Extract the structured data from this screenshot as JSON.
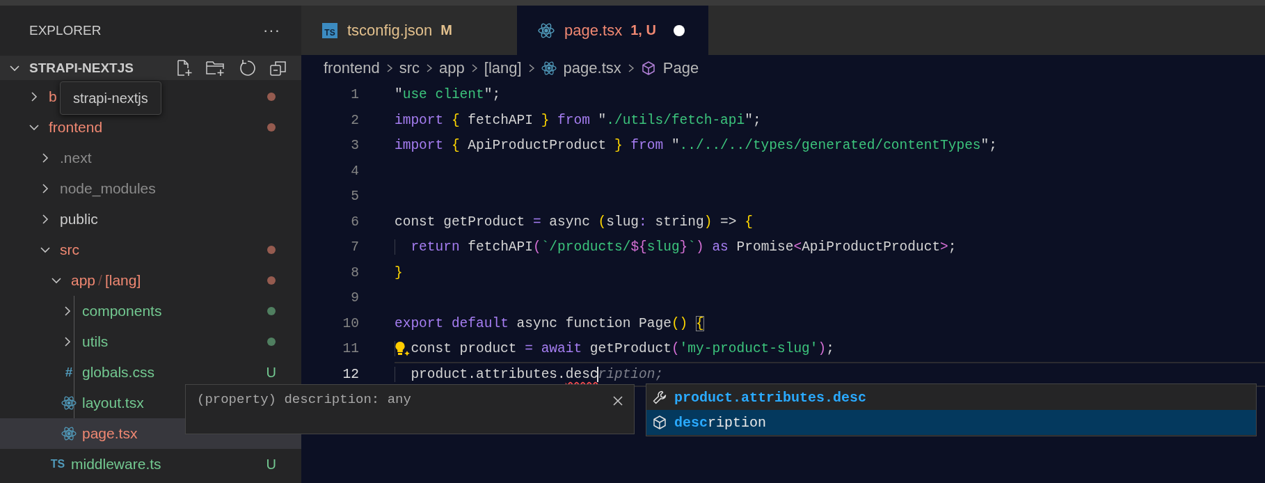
{
  "sidebar": {
    "title": "EXPLORER",
    "more": "···",
    "root": {
      "label": "STRAPI-NEXTJS",
      "expanded": true
    },
    "tooltip": "strapi-nextjs",
    "items": [
      {
        "label": "b",
        "kind": "folder",
        "expanded": false,
        "color": "#f08872",
        "dot": true,
        "selected": false
      },
      {
        "label": "frontend",
        "kind": "folder",
        "expanded": true,
        "color": "#f08872",
        "dot": true,
        "selected": false,
        "children": [
          {
            "label": ".next",
            "kind": "folder",
            "expanded": false,
            "color": "#8c8c8c",
            "dot": false,
            "selected": false
          },
          {
            "label": "node_modules",
            "kind": "folder",
            "expanded": false,
            "color": "#8c8c8c",
            "dot": false,
            "selected": false
          },
          {
            "label": "public",
            "kind": "folder",
            "expanded": false,
            "color": "#cccccc",
            "dot": false,
            "selected": false
          },
          {
            "label": "src",
            "kind": "folder",
            "expanded": true,
            "color": "#f08872",
            "dot": true,
            "selected": false,
            "children": [
              {
                "segments": [
                  "app",
                  "[lang]"
                ],
                "separator": "/",
                "kind": "folder",
                "expanded": true,
                "color": "#f08872",
                "dot": true,
                "selected": false,
                "children": [
                  {
                    "label": "components",
                    "kind": "folder",
                    "expanded": false,
                    "color": "#73c991",
                    "dot": true,
                    "selected": false
                  },
                  {
                    "label": "utils",
                    "kind": "folder",
                    "expanded": false,
                    "color": "#73c991",
                    "dot": true,
                    "selected": false
                  },
                  {
                    "label": "globals.css",
                    "kind": "css",
                    "icon_text": "#",
                    "color": "#73c991",
                    "badge": "U",
                    "selected": false
                  },
                  {
                    "label": "layout.tsx",
                    "kind": "react",
                    "color": "#73c991",
                    "selected": false
                  },
                  {
                    "label": "page.tsx",
                    "kind": "react",
                    "color": "#f08872",
                    "selected": true
                  }
                ]
              },
              {
                "label": "middleware.ts",
                "kind": "ts",
                "icon_text": "TS",
                "color": "#73c991",
                "badge": "U",
                "selected": false
              }
            ]
          }
        ]
      }
    ]
  },
  "tabs": [
    {
      "label": "tsconfig.json",
      "kind": "ts",
      "icon_text": "TS",
      "badge": "M",
      "color": "#e2c08d",
      "dirty": false,
      "selected": false
    },
    {
      "label": "page.tsx",
      "kind": "react",
      "badge": "1, U",
      "color": "#f08872",
      "dirty": true,
      "selected": true
    }
  ],
  "breadcrumb": [
    {
      "label": "frontend",
      "kind": "text"
    },
    {
      "label": "src",
      "kind": "text"
    },
    {
      "label": "app",
      "kind": "text"
    },
    {
      "label": "[lang]",
      "kind": "text"
    },
    {
      "label": "page.tsx",
      "kind": "react"
    },
    {
      "label": "Page",
      "kind": "symbol"
    }
  ],
  "editor": {
    "lines": [
      {
        "number": "1",
        "tokens": [
          {
            "t": "\"",
            "kind": "p"
          },
          {
            "t": "use client",
            "kind": "s"
          },
          {
            "t": "\";",
            "kind": "p"
          }
        ]
      },
      {
        "number": "2",
        "tokens": [
          {
            "t": "import",
            "kind": "k"
          },
          {
            "t": " {",
            "kind": "b"
          },
          {
            "t": " fetchAPI ",
            "kind": "p"
          },
          {
            "t": "}",
            "kind": "b"
          },
          {
            "t": " from",
            "kind": "k"
          },
          {
            "t": " \"",
            "kind": "p"
          },
          {
            "t": "./utils/fetch-api",
            "kind": "s"
          },
          {
            "t": "\";",
            "kind": "p"
          }
        ]
      },
      {
        "number": "3",
        "tokens": [
          {
            "t": "import",
            "kind": "k"
          },
          {
            "t": " {",
            "kind": "b"
          },
          {
            "t": " ApiProductProduct ",
            "kind": "p"
          },
          {
            "t": "}",
            "kind": "b"
          },
          {
            "t": " from",
            "kind": "k"
          },
          {
            "t": " \"",
            "kind": "p"
          },
          {
            "t": "../../../types/generated/contentTypes",
            "kind": "s"
          },
          {
            "t": "\";",
            "kind": "p"
          }
        ]
      },
      {
        "number": "4"
      },
      {
        "number": "5"
      },
      {
        "number": "6",
        "tokens": [
          {
            "t": "const getProduct ",
            "kind": "p"
          },
          {
            "t": "=",
            "kind": "o"
          },
          {
            "t": " async ",
            "kind": "p"
          },
          {
            "t": "(",
            "kind": "b"
          },
          {
            "t": "slug",
            "kind": "p"
          },
          {
            "t": ":",
            "kind": "o"
          },
          {
            "t": " string",
            "kind": "p"
          },
          {
            "t": ")",
            "kind": "b"
          },
          {
            "t": " => ",
            "kind": "p"
          },
          {
            "t": "{",
            "kind": "b"
          }
        ]
      },
      {
        "number": "7",
        "tokens": [
          {
            "t": "  return",
            "kind": "k"
          },
          {
            "t": " fetchAPI",
            "kind": "p"
          },
          {
            "t": "(",
            "kind": "m"
          },
          {
            "t": "`/products/",
            "kind": "s"
          },
          {
            "t": "${",
            "kind": "m"
          },
          {
            "t": "slug",
            "kind": "s"
          },
          {
            "t": "}",
            "kind": "m"
          },
          {
            "t": "`",
            "kind": "s"
          },
          {
            "t": ")",
            "kind": "m"
          },
          {
            "t": " as",
            "kind": "k"
          },
          {
            "t": " Promise",
            "kind": "p"
          },
          {
            "t": "<",
            "kind": "m"
          },
          {
            "t": "ApiProductProduct",
            "kind": "p"
          },
          {
            "t": ">",
            "kind": "m"
          },
          {
            "t": ";",
            "kind": "p"
          }
        ]
      },
      {
        "number": "8",
        "tokens": [
          {
            "t": "}",
            "kind": "b"
          }
        ]
      },
      {
        "number": "9"
      },
      {
        "number": "10",
        "tokens": [
          {
            "t": "export",
            "kind": "k"
          },
          {
            "t": " default",
            "kind": "k"
          },
          {
            "t": " async function Page",
            "kind": "p"
          },
          {
            "t": "() ",
            "kind": "b"
          },
          {
            "t": "{",
            "kind": "match"
          }
        ]
      },
      {
        "number": "11",
        "lightbulb": true,
        "tokens": [
          {
            "t": "  const product ",
            "kind": "p"
          },
          {
            "t": "=",
            "kind": "o"
          },
          {
            "t": " await",
            "kind": "k"
          },
          {
            "t": " getProduct",
            "kind": "p"
          },
          {
            "t": "(",
            "kind": "m"
          },
          {
            "t": "'my-product-slug'",
            "kind": "s"
          },
          {
            "t": ")",
            "kind": "m"
          },
          {
            "t": ";",
            "kind": "p"
          }
        ]
      },
      {
        "number": "12",
        "current": true,
        "tokens": [
          {
            "t": "  product.attributes.",
            "kind": "p"
          },
          {
            "t": "desc",
            "kind": "err"
          },
          {
            "t": "ription;",
            "kind": "ghost"
          }
        ]
      }
    ]
  },
  "hover": {
    "text": "(property) description: any"
  },
  "suggest": {
    "items": [
      {
        "kind": "snippet",
        "match": "product.attributes.desc",
        "selected": false
      },
      {
        "kind": "property",
        "match": "desc",
        "rest": "ription",
        "selected": true
      }
    ]
  }
}
